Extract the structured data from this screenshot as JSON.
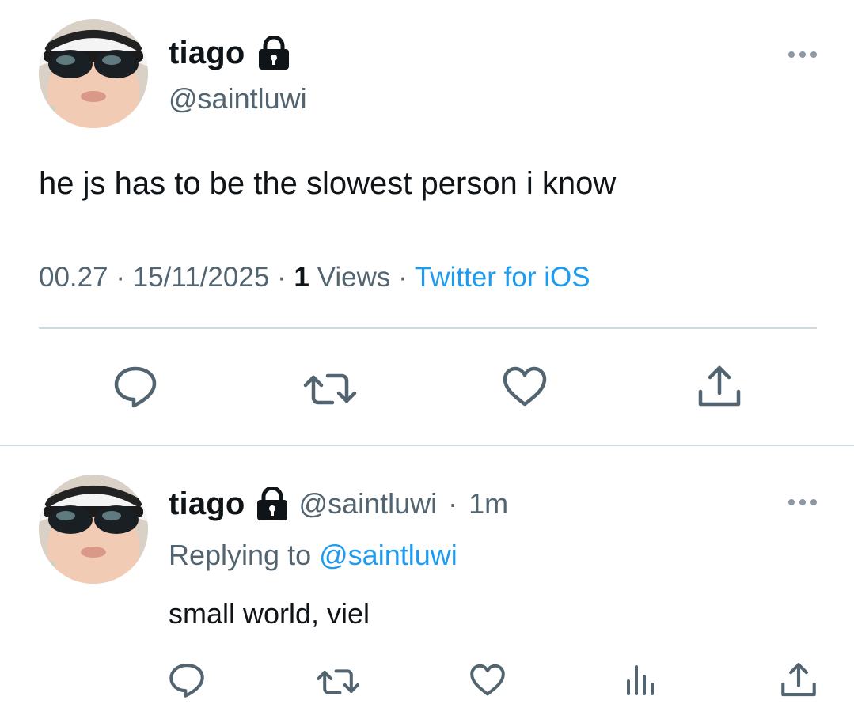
{
  "main_tweet": {
    "display_name": "tiago",
    "handle": "@saintluwi",
    "text": "he js has to be the slowest person i know",
    "time": "00.27",
    "date": "15/11/2025",
    "views_count": "1",
    "views_label": "Views",
    "source": "Twitter for iOS",
    "separator": "·"
  },
  "reply": {
    "display_name": "tiago",
    "handle": "@saintluwi",
    "age": "1m",
    "separator": "·",
    "replying_label": "Replying to",
    "replying_to": "@saintluwi",
    "text": "small world, viel"
  },
  "colors": {
    "accent": "#1d9bf0",
    "secondary_text": "#536471",
    "primary_text": "#0f1419",
    "divider": "#cfd9de"
  },
  "icons": {
    "lock": "lock-icon",
    "more": "more-icon",
    "reply": "reply-icon",
    "retweet": "retweet-icon",
    "like": "heart-icon",
    "share": "share-icon",
    "analytics": "analytics-icon"
  }
}
